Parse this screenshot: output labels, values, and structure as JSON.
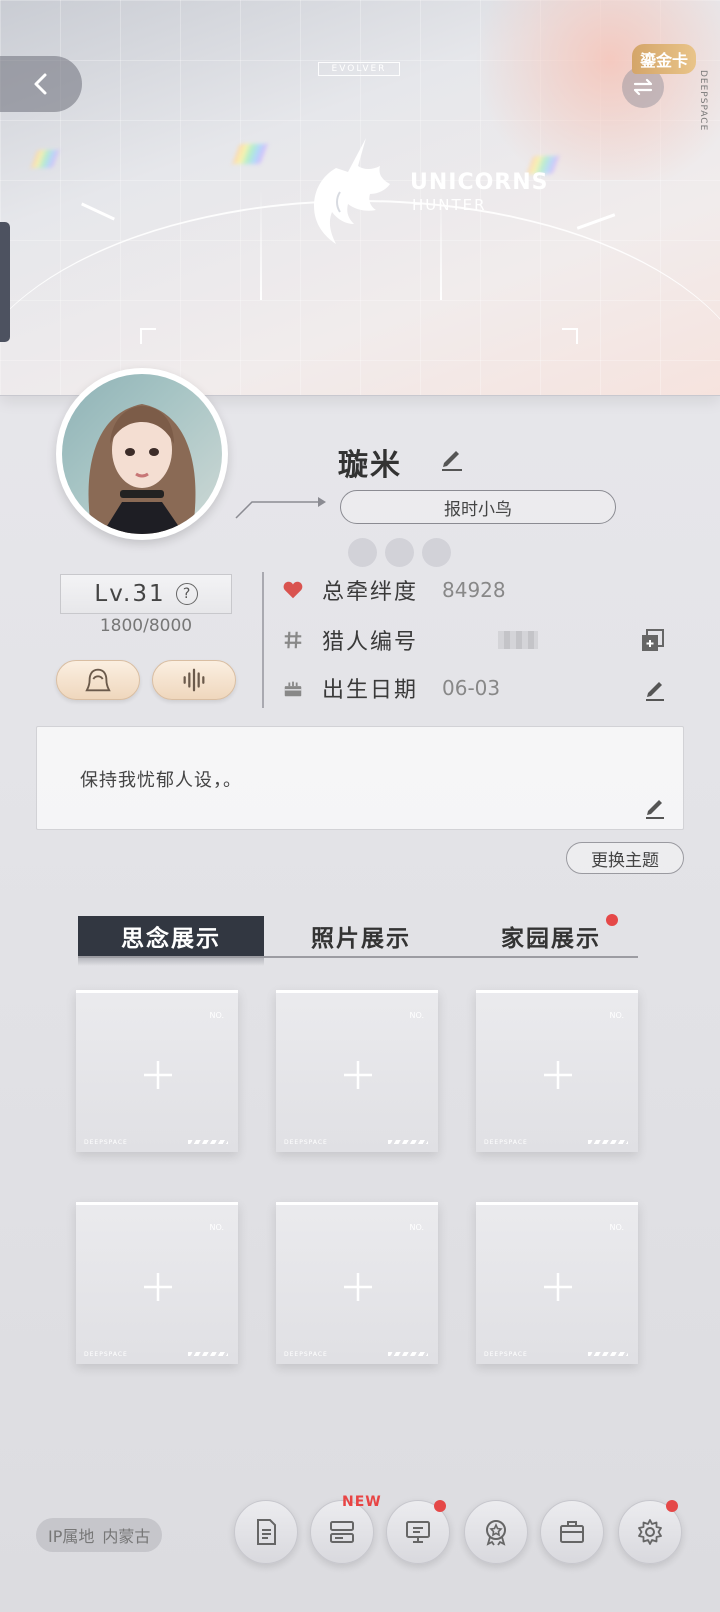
{
  "header": {
    "back_icon": "chevron-left-icon",
    "swap_icon": "swap-arrows-icon",
    "gold_badge": "鎏金卡",
    "evolver_tag": "EVOLVER",
    "logo_title": "UNICORNS",
    "logo_subtitle": "HUNTER",
    "side_brand": "DEEPSPACE"
  },
  "profile": {
    "nickname": "璇米",
    "edit_icon": "pencil-icon",
    "title": "报时小鸟",
    "level": "Lv.31",
    "exp": "1800/8000",
    "level_help_icon": "question-icon",
    "avatar_button_icon": "portrait-icon",
    "voice_button_icon": "voice-wave-icon"
  },
  "info": {
    "bond_label": "总牵绊度",
    "bond_value": "84928",
    "bond_icon": "heart-icon",
    "id_label": "猎人编号",
    "id_value": "",
    "id_icon": "hash-icon",
    "id_action_icon": "copy-icon",
    "birthday_label": "出生日期",
    "birthday_value": "06-03",
    "birthday_icon": "cake-icon",
    "birthday_action_icon": "pencil-icon"
  },
  "signature": {
    "text": "保持我忧郁人设，。",
    "edit_icon": "pencil-icon",
    "theme_button": "更换主题"
  },
  "tabs": [
    {
      "label": "思念展示",
      "active": true
    },
    {
      "label": "照片展示",
      "active": false
    },
    {
      "label": "家园展示",
      "active": false,
      "badge": "red-dot"
    }
  ],
  "slots": {
    "no_label": "NO.",
    "footer_text": "DEEPSPACE",
    "count": 6,
    "plus_icon": "plus-icon"
  },
  "bottom": {
    "ip_label": "IP属地",
    "ip_value": "内蒙古",
    "new_badge": "NEW",
    "nav_icons": [
      "document-icon",
      "cards-icon",
      "monitor-icon",
      "badge-icon",
      "briefcase-icon",
      "gear-icon"
    ]
  },
  "colors": {
    "accent_red": "#e54848",
    "tab_active_bg": "#323741",
    "gold": "#d9b07a",
    "bond_heart": "#d9534f"
  }
}
